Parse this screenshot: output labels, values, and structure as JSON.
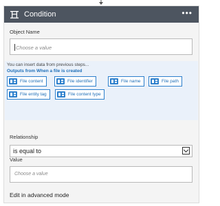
{
  "header": {
    "title": "Condition",
    "more_label": "•••"
  },
  "object_name": {
    "label": "Object Name",
    "placeholder": "Choose a value"
  },
  "dynamic": {
    "hint": "You can insert data from previous steps...",
    "source": "Outputs from When a file is created",
    "tokens": [
      {
        "label": "File content"
      },
      {
        "label": "File identifier"
      },
      {
        "label": "File name"
      },
      {
        "label": "File path"
      },
      {
        "label": "File entity tag"
      },
      {
        "label": "File content type"
      }
    ]
  },
  "relationship": {
    "label": "Relationship",
    "selected": "is equal to"
  },
  "value": {
    "label": "Value",
    "placeholder": "Choose a value"
  },
  "advanced_link": "Edit in advanced mode",
  "colors": {
    "header_bg": "#4d5560",
    "token_blue": "#2c7fcc",
    "dyn_panel_bg": "#eaf1fa"
  }
}
